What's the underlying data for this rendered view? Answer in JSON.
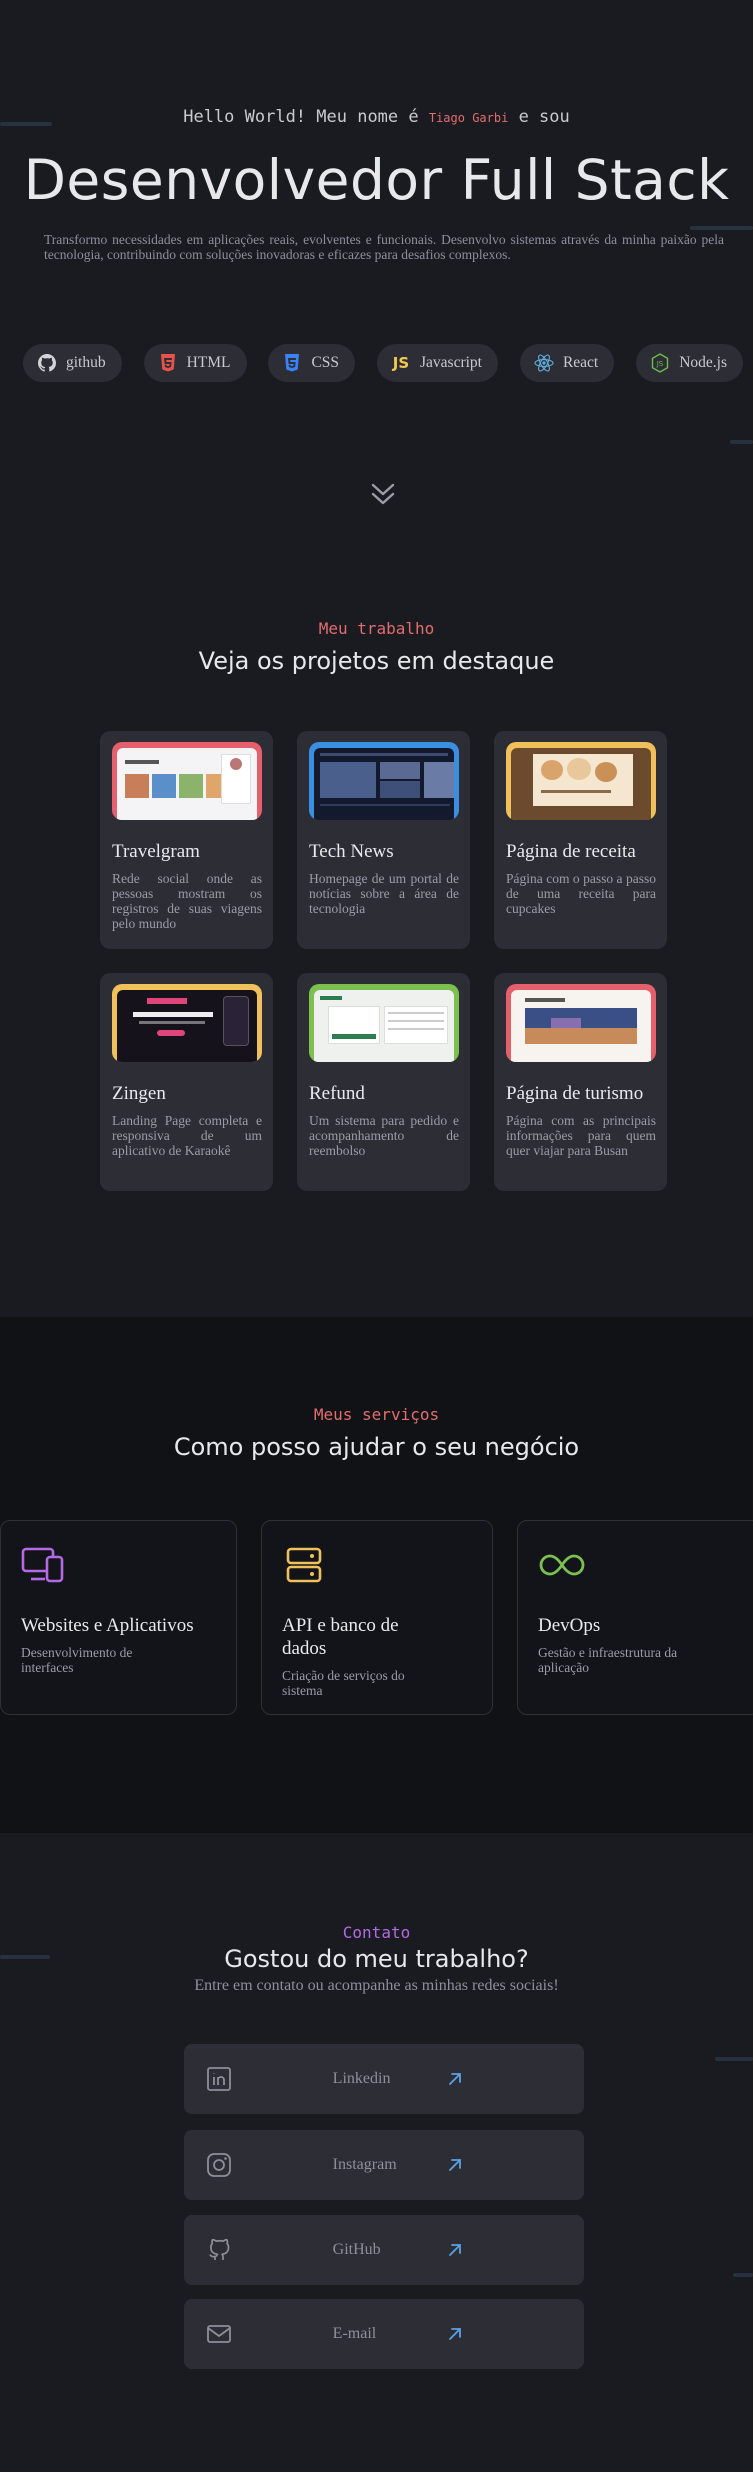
{
  "hero": {
    "greeting_prefix": "Hello World! Meu nome é ",
    "name": "Tiago Garbi",
    "greeting_suffix": " e sou",
    "title": "Desenvolvedor Full Stack",
    "description": "Transformo necessidades em aplicações reais, evolventes e funcionais. Desenvolvo sistemas através da minha paixão pela tecnologia, contribuindo com soluções inovadoras e eficazes para desafios complexos.",
    "technologies": [
      {
        "label": "github",
        "icon": "github-icon",
        "color": "#d4d4d8"
      },
      {
        "label": "HTML",
        "icon": "html5-icon",
        "color": "#e5534b"
      },
      {
        "label": "CSS",
        "icon": "css3-icon",
        "color": "#3b82f6"
      },
      {
        "label": "Javascript",
        "icon": "javascript-icon",
        "color": "#f2c94c"
      },
      {
        "label": "React",
        "icon": "react-icon",
        "color": "#61aee0"
      },
      {
        "label": "Node.js",
        "icon": "nodejs-icon",
        "color": "#6cc04a"
      }
    ]
  },
  "projects": {
    "kicker": "Meu trabalho",
    "title": "Veja os projetos em destaque",
    "items": [
      {
        "title": "Travelgram",
        "description": "Rede social onde as pessoas mostram os registros de suas viagens pelo mundo",
        "accent": "#e5606c"
      },
      {
        "title": "Tech News",
        "description": "Homepage de um portal de notícias sobre a área de tecnologia",
        "accent": "#3b8fe0"
      },
      {
        "title": "Página de receita",
        "description": "Página com o passo a passo de uma receita para cupcakes",
        "accent": "#f0c05a"
      },
      {
        "title": "Zingen",
        "description": "Landing Page completa e responsiva de um aplicativo de Karaokê",
        "accent": "#f0c05a"
      },
      {
        "title": "Refund",
        "description": "Um sistema para pedido e acompanhamento de reembolso",
        "accent": "#7cc04f"
      },
      {
        "title": "Página de turismo",
        "description": "Página com as principais informações para quem quer viajar para Busan",
        "accent": "#e5606c"
      }
    ]
  },
  "services": {
    "kicker": "Meus serviços",
    "title": "Como posso ajudar o seu negócio",
    "items": [
      {
        "title": "Websites e Aplicativos",
        "description": "Desenvolvimento de interfaces",
        "icon": "devices-icon",
        "color": "#b46ae6"
      },
      {
        "title": "API e banco de dados",
        "description": "Criação de serviços do sistema",
        "icon": "server-icon",
        "color": "#f0c05a"
      },
      {
        "title": "DevOps",
        "description": "Gestão e infraestrutura da aplicação",
        "icon": "infinity-icon",
        "color": "#7cc04f"
      }
    ]
  },
  "contact": {
    "kicker": "Contato",
    "title": "Gostou do meu trabalho?",
    "subtitle": "Entre em contato ou acompanhe as minhas redes sociais!",
    "links": [
      {
        "label": "Linkedin",
        "icon": "linkedin-icon"
      },
      {
        "label": "Instagram",
        "icon": "instagram-icon"
      },
      {
        "label": "GitHub",
        "icon": "github-icon"
      },
      {
        "label": "E-mail",
        "icon": "mail-icon"
      }
    ]
  },
  "colors": {
    "kicker_red": "#e36d6d",
    "kicker_purple": "#b46ae6",
    "arrow_blue": "#5aa3e6"
  }
}
